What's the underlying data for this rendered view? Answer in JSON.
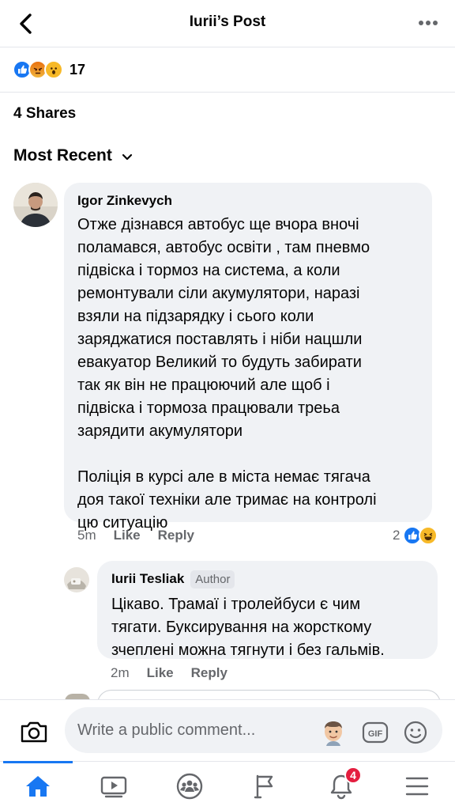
{
  "header": {
    "title": "Iurii’s Post"
  },
  "reactions": {
    "count": "17",
    "icons": [
      "like-reaction",
      "angry-reaction",
      "wow-reaction"
    ]
  },
  "shares": {
    "label": "4 Shares"
  },
  "sort": {
    "label": "Most Recent"
  },
  "comments": [
    {
      "author": "Igor Zinkevych",
      "text": "Отже дізнався автобус ще вчора вночі\nполамався, автобус освіти , там пневмо\nпідвіска і тормоз на система, а коли\nремонтували сіли акумулятори, наразі\nвзяли на підзарядку і сього коли\nзаряджатися поставлять і ніби нацшли\nевакуатор Великий то будуть забирати\nтак як він не працюючий але щоб і\nпідвіска і тормоза працювали треьа\nзарядити акумулятори\n\nПоліція в курсі але в міста немає тягача\nдоя такої техніки але тримає на контролі\nцю ситуацію",
      "time": "5m",
      "like_label": "Like",
      "reply_label": "Reply",
      "reaction_count": "2"
    },
    {
      "author": "Iurii Tesliak",
      "badge": "Author",
      "text": "Цікаво. Трамаї і тролейбуси є чим\nтягати. Буксирування на жорсткому\nзчеплені можна тягнути і без гальмів.",
      "time": "2m",
      "like_label": "Like",
      "reply_label": "Reply"
    }
  ],
  "composer": {
    "placeholder": "Write a public comment..."
  },
  "tabbar": {
    "notifications_badge": "4"
  },
  "colors": {
    "accent": "#1877f2",
    "bubble": "#f0f2f5",
    "secondary_text": "#65676b",
    "badge": "#e41e3f"
  }
}
